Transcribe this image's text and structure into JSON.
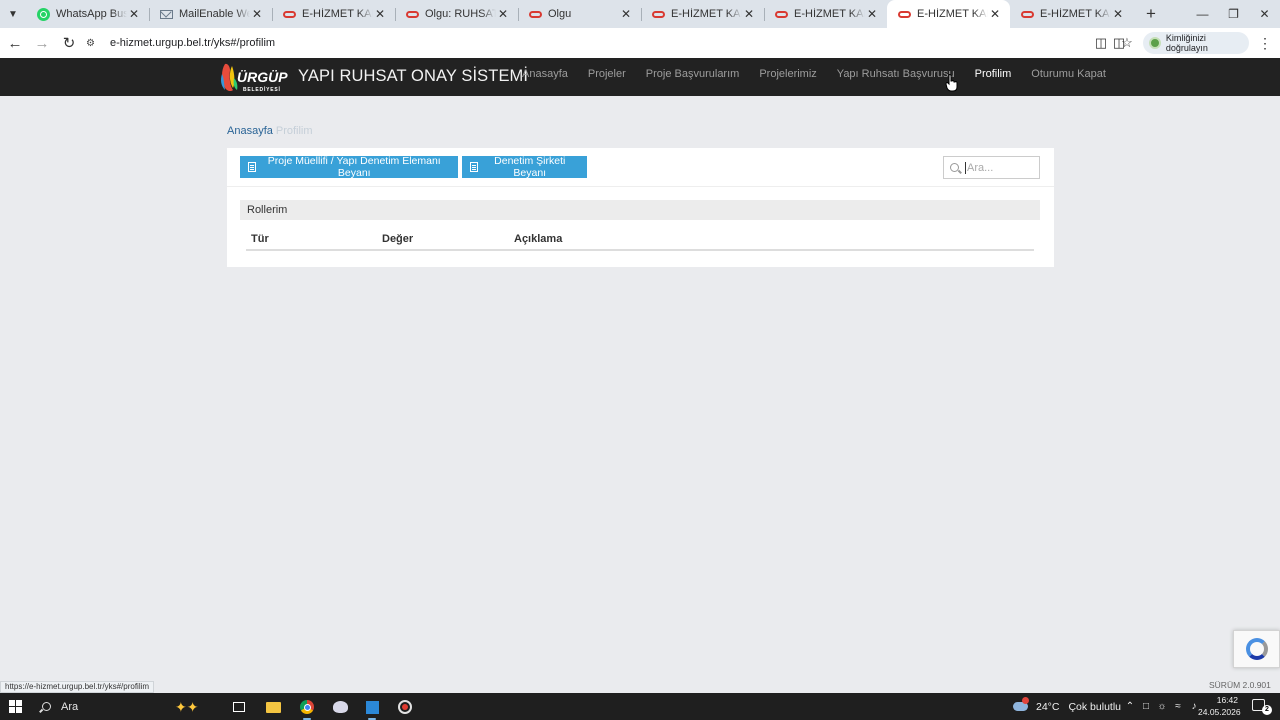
{
  "browser": {
    "tabs": [
      {
        "title": "WhatsApp Business",
        "icon": "whatsapp-icon",
        "active": false
      },
      {
        "title": "MailEnable Web Mail",
        "icon": "mail-icon",
        "active": false
      },
      {
        "title": "E-HİZMET KAPISI - A",
        "icon": "pill-icon",
        "active": false
      },
      {
        "title": "Olgu: RUHSAT BAŞVU",
        "icon": "pill-icon",
        "active": false
      },
      {
        "title": "Olgu",
        "icon": "pill-icon",
        "active": false
      },
      {
        "title": "E-HİZMET KAPISI - A",
        "icon": "pill-icon",
        "active": false
      },
      {
        "title": "E-HİZMET KAPISI - A",
        "icon": "pill-icon",
        "active": false
      },
      {
        "title": "E-HİZMET KAPISI - P",
        "icon": "pill-icon",
        "active": true
      },
      {
        "title": "E-HİZMET KAPISI - P",
        "icon": "pill-icon",
        "active": false
      }
    ],
    "url": "e-hizmet.urgup.bel.tr/yks#/profilim",
    "identity_label": "Kimliğinizi doğrulayın",
    "status_url": "https://e-hizmet.urgup.bel.tr/yks#/profilim"
  },
  "app": {
    "logo_text": "ÜRGÜP",
    "logo_subtext": "BELEDİYESİ",
    "brand": "YAPI RUHSAT ONAY SİSTEMİ",
    "menu": [
      {
        "label": "Anasayfa",
        "active": false
      },
      {
        "label": "Projeler",
        "active": false
      },
      {
        "label": "Proje Başvurularım",
        "active": false
      },
      {
        "label": "Projelerimiz",
        "active": false
      },
      {
        "label": "Yapı Ruhsatı Başvurusu",
        "active": false
      },
      {
        "label": "Profilim",
        "active": true
      },
      {
        "label": "Oturumu Kapat",
        "active": false
      }
    ],
    "breadcrumb": {
      "home": "Anasayfa",
      "current": "Profilim"
    },
    "buttons": {
      "declaration_1": "Proje Müellifi / Yapı Denetim Elemanı Beyanı",
      "declaration_2": "Denetim Şirketi Beyanı"
    },
    "search": {
      "placeholder": "Ara...",
      "value": ""
    },
    "roles_title": "Rollerim",
    "table_headers": [
      "Tür",
      "Değer",
      "Açıklama"
    ],
    "version": "SÜRÜM 2.0.901",
    "colors": {
      "navbar": "#222222",
      "button": "#39a1d8",
      "link": "#2a6496"
    }
  },
  "taskbar": {
    "search_label": "Ara",
    "weather_temp": "24°C",
    "weather_desc": "Çok bulutlu",
    "time": "16:42",
    "date": "24.05.2026",
    "notification_count": "2"
  }
}
